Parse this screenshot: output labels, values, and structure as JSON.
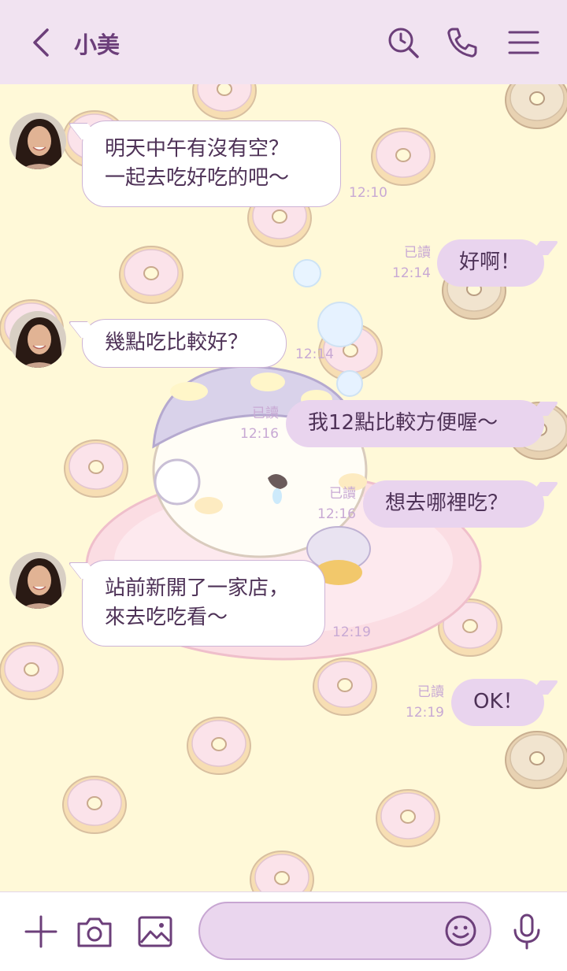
{
  "header": {
    "title": "小美",
    "icons": [
      "back-icon",
      "search-history-icon",
      "phone-icon",
      "menu-icon"
    ]
  },
  "messages": [
    {
      "side": "in",
      "text": "明天中午有沒有空？\n一起去吃好吃的吧～",
      "time": "12:10"
    },
    {
      "side": "out",
      "text": "好啊！",
      "read": "已讀",
      "time": "12:14"
    },
    {
      "side": "in",
      "text": "幾點吃比較好？",
      "time": "12:14"
    },
    {
      "side": "out",
      "text": "我12點比較方便喔～",
      "read": "已讀",
      "time": "12:16"
    },
    {
      "side": "out",
      "text": "想去哪裡吃？",
      "read": "已讀",
      "time": "12:16"
    },
    {
      "side": "in",
      "text": "站前新開了一家店，\n來去吃吃看～",
      "time": "12:19"
    },
    {
      "side": "out",
      "text": "OK！",
      "read": "已讀",
      "time": "12:19"
    }
  ],
  "footer": {
    "message_value": "",
    "icons": [
      "plus-icon",
      "camera-icon",
      "image-icon",
      "emoji-icon",
      "microphone-icon"
    ]
  },
  "colors": {
    "header_bg": "#f1e3f1",
    "accent": "#6c3f7a",
    "bubble_out": "#e9d4ee",
    "chat_bg": "#fff9d8",
    "meta_text": "#c8a9d4"
  }
}
